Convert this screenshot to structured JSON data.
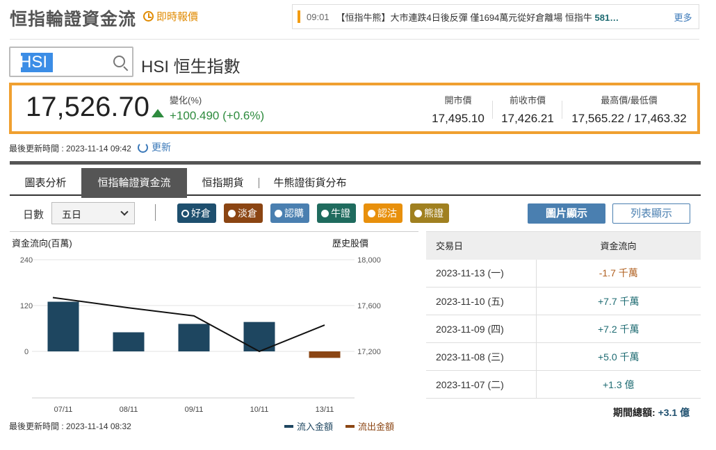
{
  "header": {
    "title": "恒指輪證資金流",
    "realtime_label": "即時報價",
    "ticker": {
      "time": "09:01",
      "headline_main": "【恒指牛熊】大市連跌4日後反彈 僅1694萬元從好倉離場 恒指牛",
      "headline_bold": "581…",
      "more": "更多"
    }
  },
  "search": {
    "value": "HSI"
  },
  "stock": {
    "name": "HSI 恒生指數"
  },
  "quote": {
    "price": "17,526.70",
    "change_label": "變化(%)",
    "change_value": "+100.490 (+0.6%)",
    "open_label": "開市價",
    "open_value": "17,495.10",
    "prev_label": "前收市價",
    "prev_value": "17,426.21",
    "range_label": "最高價/最低價",
    "range_value": "17,565.22 / 17,463.32"
  },
  "update1": "最後更新時間 : 2023-11-14 09:42",
  "refresh_label": "更新",
  "tabs": [
    "圖表分析",
    "恒指輪證資金流",
    "恒指期貨",
    "牛熊證街貨分布"
  ],
  "controls": {
    "days_label": "日數",
    "days_value": "五日",
    "filters": [
      {
        "label": "好倉",
        "color": "#1e4f6e"
      },
      {
        "label": "淡倉",
        "color": "#8b4513"
      },
      {
        "label": "認購",
        "color": "#4a7fb0"
      },
      {
        "label": "牛證",
        "color": "#1f6b5e"
      },
      {
        "label": "認沽",
        "color": "#e8900c"
      },
      {
        "label": "熊證",
        "color": "#a08020"
      }
    ],
    "chart_view": "圖片顯示",
    "list_view": "列表顯示"
  },
  "chart_data": {
    "type": "bar",
    "left_axis_label": "資金流向(百萬)",
    "right_axis_label": "歷史股價",
    "categories": [
      "07/11",
      "08/11",
      "09/11",
      "10/11",
      "13/11"
    ],
    "left_ticks": [
      "240",
      "120",
      "0"
    ],
    "right_ticks": [
      "18,000",
      "17,600",
      "17,200"
    ],
    "ylim_left": [
      0,
      240
    ],
    "ylim_right": [
      17200,
      18000
    ],
    "flow_values": [
      130,
      50,
      72,
      77,
      -17
    ],
    "price_values": [
      17670,
      17580,
      17510,
      17200,
      17430
    ],
    "legend_in": "流入金額",
    "legend_out": "流出金額",
    "color_in": "#1e4660",
    "color_out": "#8b4513"
  },
  "update2": "最後更新時間 : 2023-11-14 08:32",
  "table": {
    "col_date": "交易日",
    "col_flow": "資金流向",
    "rows": [
      {
        "date": "2023-11-13 (一)",
        "flow": "-1.7 千萬",
        "dir": "neg"
      },
      {
        "date": "2023-11-10 (五)",
        "flow": "+7.7 千萬",
        "dir": "pos"
      },
      {
        "date": "2023-11-09 (四)",
        "flow": "+7.2 千萬",
        "dir": "pos"
      },
      {
        "date": "2023-11-08 (三)",
        "flow": "+5.0 千萬",
        "dir": "pos"
      },
      {
        "date": "2023-11-07 (二)",
        "flow": "+1.3 億",
        "dir": "pos"
      }
    ],
    "total_label": "期間總額:",
    "total_value": "+3.1 億"
  }
}
